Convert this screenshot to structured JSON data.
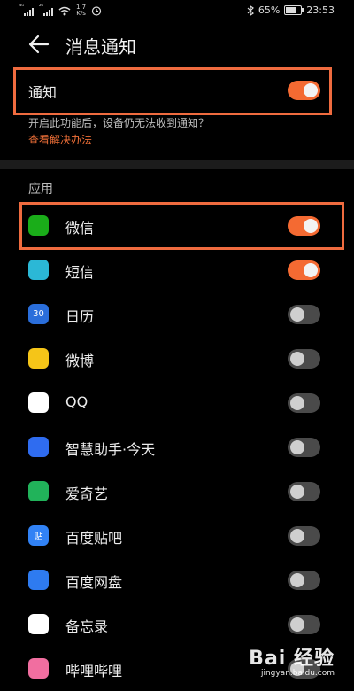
{
  "status": {
    "signal1_label": "⁴ᴳ",
    "signal2_label": "²ᴳ",
    "net_speed_value": "1.7",
    "net_speed_unit": "K/s",
    "battery": "65%",
    "time": "23:53"
  },
  "header": {
    "title": "消息通知"
  },
  "master": {
    "label": "通知",
    "on": true
  },
  "hint": {
    "text": "开启此功能后，设备仍无法收到通知？",
    "link": "查看解决办法"
  },
  "section_title": "应用",
  "apps": [
    {
      "name": "微信",
      "on": true,
      "icon": "wechat-icon",
      "color": "#1aad19"
    },
    {
      "name": "短信",
      "on": true,
      "icon": "sms-icon",
      "color": "#2bb8d6"
    },
    {
      "name": "日历",
      "on": false,
      "icon": "calendar-icon",
      "color": "#2a6edb",
      "glyph": "30"
    },
    {
      "name": "微博",
      "on": false,
      "icon": "weibo-icon",
      "color": "#f5c518"
    },
    {
      "name": "QQ",
      "on": false,
      "icon": "qq-icon",
      "color": "#ffffff"
    },
    {
      "name": "智慧助手·今天",
      "on": false,
      "icon": "assistant-icon",
      "color": "#2f6cf0"
    },
    {
      "name": "爱奇艺",
      "on": false,
      "icon": "iqiyi-icon",
      "color": "#21b35a"
    },
    {
      "name": "百度贴吧",
      "on": false,
      "icon": "tieba-icon",
      "color": "#3182f5",
      "glyph": "贴"
    },
    {
      "name": "百度网盘",
      "on": false,
      "icon": "netdisk-icon",
      "color": "#2e7bf0"
    },
    {
      "name": "备忘录",
      "on": false,
      "icon": "notes-icon",
      "color": "#ffffff"
    },
    {
      "name": "哔哩哔哩",
      "on": false,
      "icon": "bilibili-icon",
      "color": "#f16ea0"
    }
  ],
  "watermark": {
    "main": "Bai 经验",
    "sub": "jingyan.baidu.com"
  },
  "colors": {
    "accent": "#f46a32",
    "highlight": "#ef6b3f"
  }
}
